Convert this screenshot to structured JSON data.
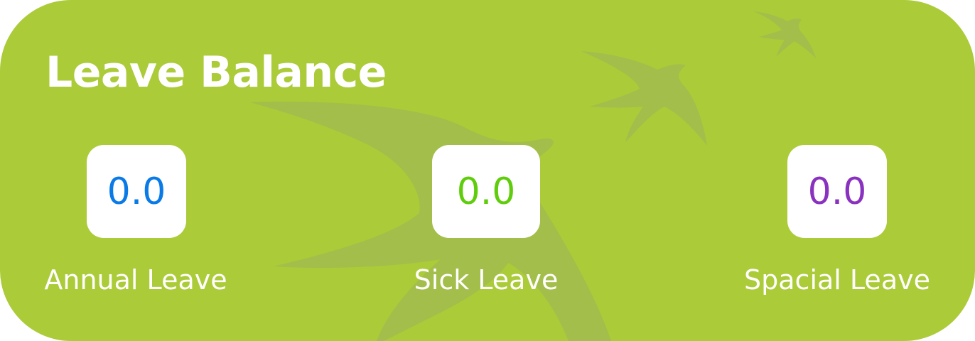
{
  "colors": {
    "card_background": "#abcb39",
    "bird_shape": "#a1bc4e",
    "annual_value_color": "#0a7ae6",
    "sick_value_color": "#5fcd0c",
    "special_value_color": "#8a32c0"
  },
  "card": {
    "title": "Leave Balance",
    "decoration_icon": "swallow-bird-silhouettes"
  },
  "balances": [
    {
      "value": "0.0",
      "label": "Annual Leave"
    },
    {
      "value": "0.0",
      "label": "Sick Leave"
    },
    {
      "value": "0.0",
      "label": "Spacial Leave"
    }
  ]
}
